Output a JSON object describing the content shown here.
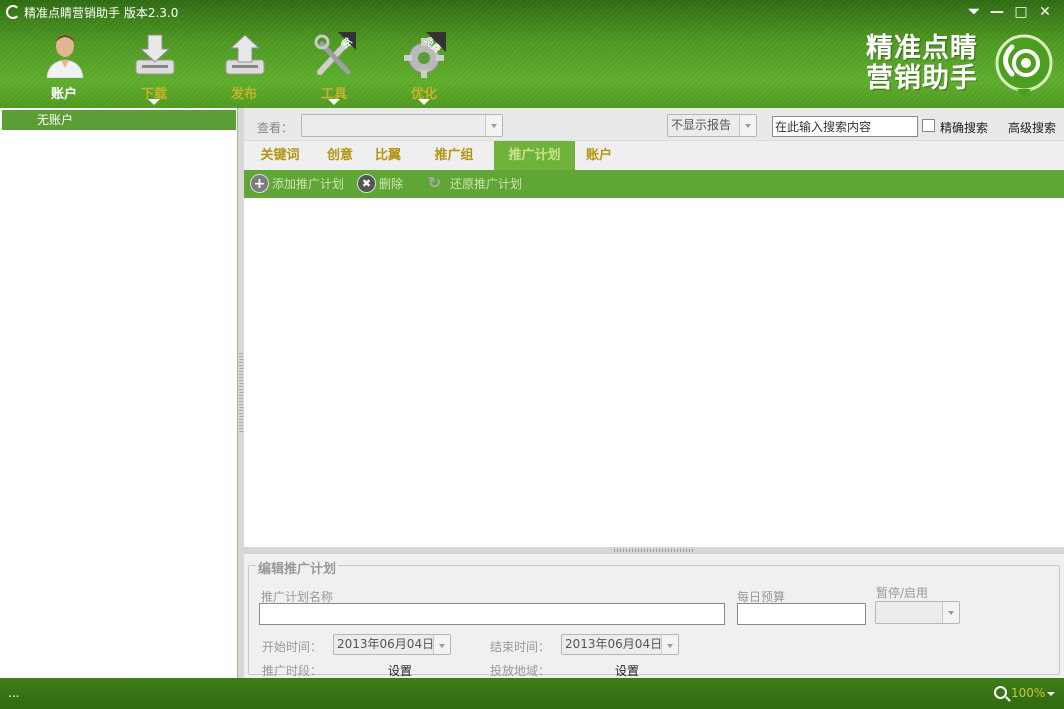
{
  "window": {
    "title": "精准点睛营销助手 版本2.3.0",
    "controls": {
      "dropdown": "⏷",
      "minimize": "—",
      "maximize": "□",
      "close": "✕"
    }
  },
  "toolbar": {
    "items": [
      {
        "label": "账户",
        "icon": "user-icon",
        "label_color": "#ffffff",
        "has_menu": false
      },
      {
        "label": "下载",
        "icon": "download-icon",
        "label_color": "#c8b229",
        "has_menu": true
      },
      {
        "label": "发布",
        "icon": "upload-icon",
        "label_color": "#c8b229",
        "has_menu": false
      },
      {
        "label": "工具",
        "icon": "tools-icon",
        "badge": "新",
        "label_color": "#c8b229",
        "has_menu": true
      },
      {
        "label": "优化",
        "icon": "gear-icon",
        "badge": "免费",
        "label_color": "#c8b229",
        "has_menu": true
      }
    ]
  },
  "brand": {
    "line1": "精准点睛",
    "line2": "营销助手",
    "logo": "eye-logo"
  },
  "sidebar": {
    "account_item": "无账户"
  },
  "filter_bar": {
    "view_label": "查看：",
    "view_value": "",
    "report_value": "不显示报告",
    "search_value": "在此输入搜索内容",
    "exact_label": "精确搜索",
    "exact_checked": false,
    "advanced_label": "高级搜索"
  },
  "tabs": [
    {
      "label": "关键词",
      "active": false
    },
    {
      "label": "创意",
      "active": false
    },
    {
      "label": "比翼",
      "active": false
    },
    {
      "label": "推广组",
      "active": false
    },
    {
      "label": "推广计划",
      "active": true
    },
    {
      "label": "账户",
      "active": false
    }
  ],
  "actions": [
    {
      "label": "添加推广计划",
      "icon": "add-icon"
    },
    {
      "label": "删除",
      "icon": "delete-icon"
    },
    {
      "label": "还原推广计划",
      "icon": "restore-icon"
    }
  ],
  "edit_panel": {
    "title": "编辑推广计划",
    "name_label": "推广计划名称",
    "name_value": "",
    "budget_label": "每日预算",
    "budget_value": "",
    "status_label": "暂停/启用",
    "status_value": "",
    "start_label": "开始时间：",
    "start_value": "2013年06月04日",
    "end_label": "结束时间：",
    "end_value": "2013年06月04日",
    "period_label": "推广时段：",
    "period_link": "设置",
    "region_label": "投放地域：",
    "region_link": "设置"
  },
  "status_bar": {
    "text": "...",
    "zoom": "100%"
  },
  "colors": {
    "header_green": "#4f9a22",
    "active_tab": "#6fb23c",
    "tab_text": "#b39512",
    "action_bar": "#5fa636",
    "account_row": "#5a9e35"
  }
}
